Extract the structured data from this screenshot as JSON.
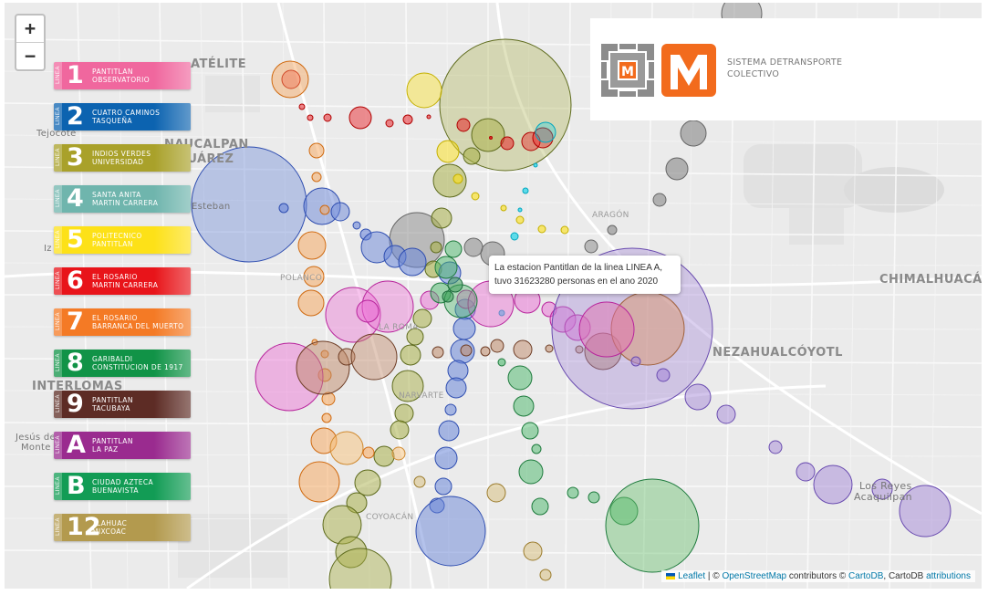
{
  "map": {
    "zoom_in": "+",
    "zoom_out": "−",
    "place_labels": {
      "atelite": "ATÉLITE",
      "naucalpan": "NAUCALPAN",
      "juarez": "JUÁREZ",
      "tejocote": "Tejocote",
      "esteban": "Esteban",
      "iz": "Iz",
      "polanco": "POLANCO",
      "la_roma": "LA ROMA",
      "narvarte": "NARVARTE",
      "interlomas": "INTERLOMAS",
      "jesus_de_monte_1": "Jesús de",
      "jesus_de_monte_2": "Monte",
      "coyoacan": "COYOACÁN",
      "aragon": "ARAGÓN",
      "chimalhuacan": "CHIMALHUACÁI",
      "nezahualcoyotl": "NEZAHUALCÓYOTL",
      "los_reyes_1": "Los Reyes",
      "los_reyes_2": "Acaquilpan"
    }
  },
  "legend": [
    {
      "tag": "LINEA",
      "num": "1",
      "line1": "PANTITLAN",
      "line2": "OBSERVATORIO",
      "color": "#f0679e"
    },
    {
      "tag": "LINEA",
      "num": "2",
      "line1": "CUATRO CAMINOS",
      "line2": "TASQUEÑA",
      "color": "#0c63b0"
    },
    {
      "tag": "LINEA",
      "num": "3",
      "line1": "INDIOS VERDES",
      "line2": "UNIVERSIDAD",
      "color": "#a9a12a"
    },
    {
      "tag": "LINEA",
      "num": "4",
      "line1": "SANTA ANITA",
      "line2": "MARTIN CARRERA",
      "color": "#6fb5ad"
    },
    {
      "tag": "LINEA",
      "num": "5",
      "line1": "POLITECNICO",
      "line2": "PANTITLAN",
      "color": "#fde118"
    },
    {
      "tag": "LINEA",
      "num": "6",
      "line1": "EL ROSARIO",
      "line2": "MARTIN CARRERA",
      "color": "#e8141a"
    },
    {
      "tag": "LINEA",
      "num": "7",
      "line1": "EL ROSARIO",
      "line2": "BARRANCA DEL MUERTO",
      "color": "#f47a25"
    },
    {
      "tag": "LINEA",
      "num": "8",
      "line1": "GARIBALDI",
      "line2": "CONSTITUCION DE 1917",
      "color": "#119347"
    },
    {
      "tag": "LINEA",
      "num": "9",
      "line1": "PANTITLAN",
      "line2": "TACUBAYA",
      "color": "#5d2c25"
    },
    {
      "tag": "LINEA",
      "num": "A",
      "line1": "PANTITLAN",
      "line2": "LA PAZ",
      "color": "#9a2b8f"
    },
    {
      "tag": "LINEA",
      "num": "B",
      "line1": "CIUDAD AZTECA",
      "line2": "BUENAVISTA",
      "color": "#129c55"
    },
    {
      "tag": "LINEA",
      "num": "12",
      "line1": "TLAHUAC",
      "line2": "MIXCOAC",
      "color": "#b39a4e"
    }
  ],
  "logo": {
    "line1": "SISTEMA DETRANSPORTE",
    "line2": "COLECTIVO",
    "orange": "#f26b1d"
  },
  "tooltip": {
    "line1": "La estacion Pantitlan de la linea LINEA A,",
    "line2": "tuvo 31623280 personas en el ano 2020"
  },
  "attribution": {
    "leaflet": "Leaflet",
    "sep1": " | © ",
    "osm": "OpenStreetMap",
    "mid": " contributors © ",
    "cartodb": "CartoDB",
    "mid2": ", CartoDB ",
    "attributions": "attributions"
  }
}
